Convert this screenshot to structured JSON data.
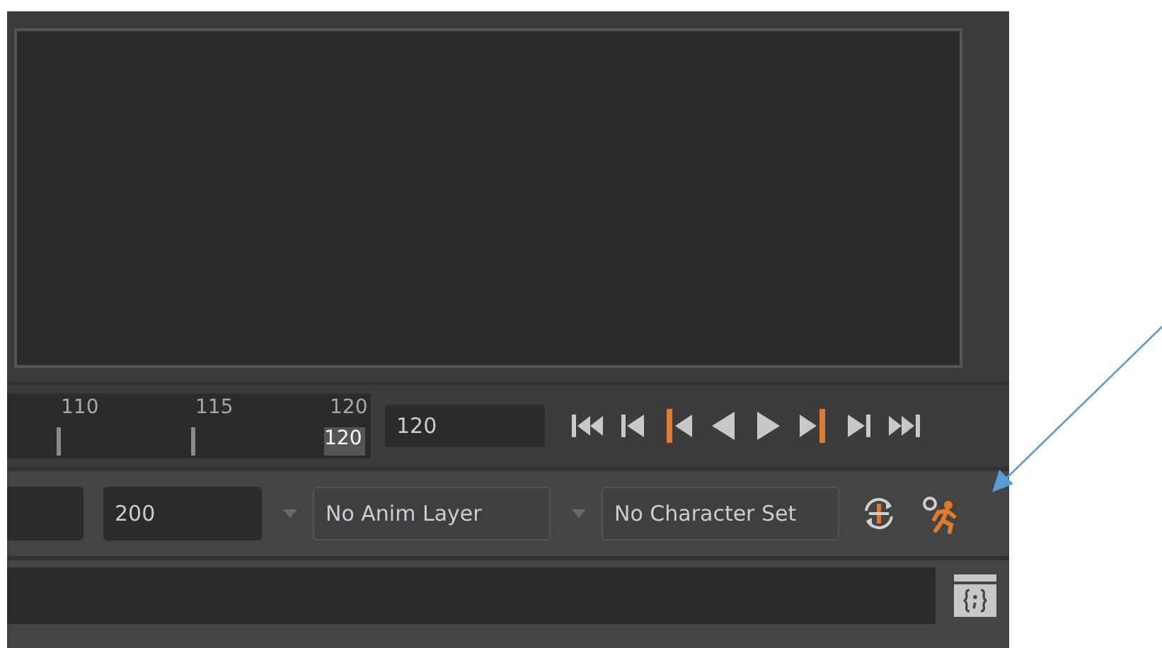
{
  "timeline": {
    "ticks": [
      {
        "label": "110"
      },
      {
        "label": "115"
      },
      {
        "label": "120"
      }
    ],
    "current_frame": "120"
  },
  "current_time_field": {
    "value": "120"
  },
  "range": {
    "end_value": "200"
  },
  "anim_layer": {
    "label": "No Anim Layer"
  },
  "character_set": {
    "label": "No Character Set"
  },
  "annotation": {
    "kind": "arrow"
  }
}
